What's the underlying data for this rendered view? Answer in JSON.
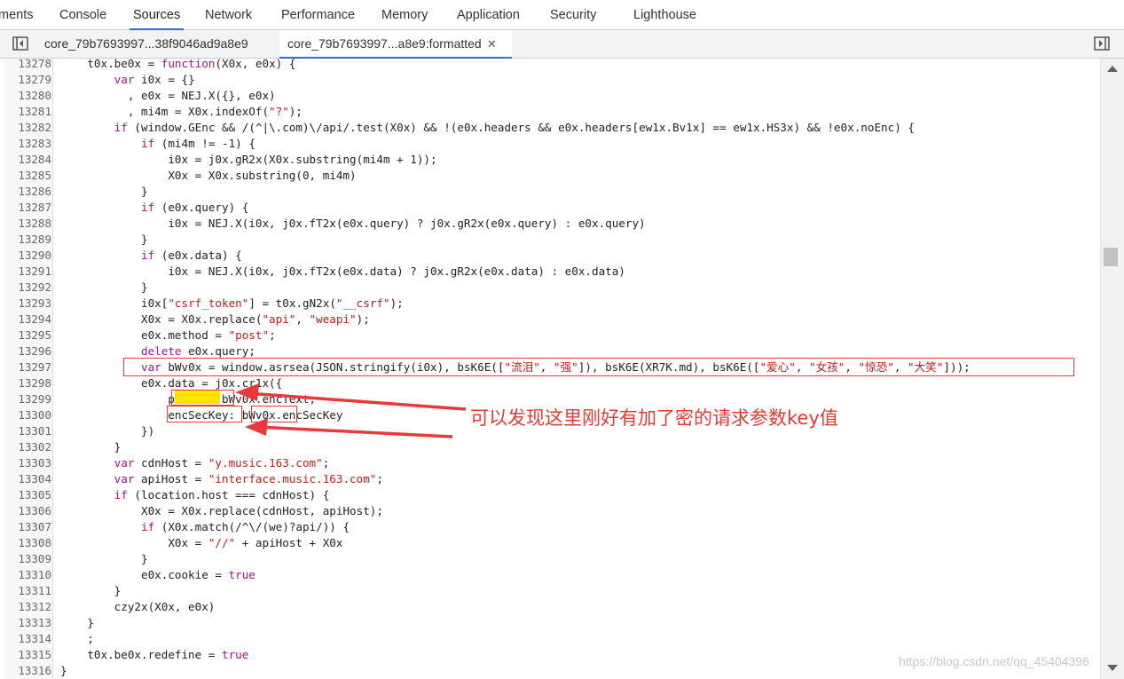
{
  "devtools_tabs": [
    {
      "label": "ments"
    },
    {
      "label": "Console"
    },
    {
      "label": "Sources"
    },
    {
      "label": "Network"
    },
    {
      "label": "Performance"
    },
    {
      "label": "Memory"
    },
    {
      "label": "Application"
    },
    {
      "label": "Security"
    },
    {
      "label": "Lighthouse"
    }
  ],
  "active_tab": "Sources",
  "file_tabs": [
    {
      "label": "core_79b7693997...38f9046ad9a8e9"
    },
    {
      "label": "core_79b7693997...a8e9:formatted"
    }
  ],
  "close_glyph": "✕",
  "lines": [
    {
      "n": "13278",
      "t": "    t0x.be0x = function(X0x, e0x) {"
    },
    {
      "n": "13279",
      "t": "        var i0x = {}"
    },
    {
      "n": "13280",
      "t": "          , e0x = NEJ.X({}, e0x)"
    },
    {
      "n": "13281",
      "t": "          , mi4m = X0x.indexOf(\"?\");"
    },
    {
      "n": "13282",
      "t": "        if (window.GEnc && /(^|\\.com)\\/api/.test(X0x) && !(e0x.headers && e0x.headers[ew1x.Bv1x] == ew1x.HS3x) && !e0x.noEnc) {"
    },
    {
      "n": "13283",
      "t": "            if (mi4m != -1) {"
    },
    {
      "n": "13284",
      "t": "                i0x = j0x.gR2x(X0x.substring(mi4m + 1));"
    },
    {
      "n": "13285",
      "t": "                X0x = X0x.substring(0, mi4m)"
    },
    {
      "n": "13286",
      "t": "            }"
    },
    {
      "n": "13287",
      "t": "            if (e0x.query) {"
    },
    {
      "n": "13288",
      "t": "                i0x = NEJ.X(i0x, j0x.fT2x(e0x.query) ? j0x.gR2x(e0x.query) : e0x.query)"
    },
    {
      "n": "13289",
      "t": "            }"
    },
    {
      "n": "13290",
      "t": "            if (e0x.data) {"
    },
    {
      "n": "13291",
      "t": "                i0x = NEJ.X(i0x, j0x.fT2x(e0x.data) ? j0x.gR2x(e0x.data) : e0x.data)"
    },
    {
      "n": "13292",
      "t": "            }"
    },
    {
      "n": "13293",
      "t": "            i0x[\"csrf_token\"] = t0x.gN2x(\"__csrf\");"
    },
    {
      "n": "13294",
      "t": "            X0x = X0x.replace(\"api\", \"weapi\");"
    },
    {
      "n": "13295",
      "t": "            e0x.method = \"post\";"
    },
    {
      "n": "13296",
      "t": "            delete e0x.query;"
    },
    {
      "n": "13297",
      "t": "            var bWv0x = window.asrsea(JSON.stringify(i0x), bsK6E([\"流泪\", \"强\"]), bsK6E(XR7K.md), bsK6E([\"爱心\", \"女孩\", \"惊恐\", \"大笑\"]));"
    },
    {
      "n": "13298",
      "t": "            e0x.data = j0x.cr1x({"
    },
    {
      "n": "13299",
      "t": "                params: bWv0x.encText,"
    },
    {
      "n": "13300",
      "t": "                encSecKey: bWv0x.encSecKey"
    },
    {
      "n": "13301",
      "t": "            })"
    },
    {
      "n": "13302",
      "t": "        }"
    },
    {
      "n": "13303",
      "t": "        var cdnHost = \"y.music.163.com\";"
    },
    {
      "n": "13304",
      "t": "        var apiHost = \"interface.music.163.com\";"
    },
    {
      "n": "13305",
      "t": "        if (location.host === cdnHost) {"
    },
    {
      "n": "13306",
      "t": "            X0x = X0x.replace(cdnHost, apiHost);"
    },
    {
      "n": "13307",
      "t": "            if (X0x.match(/^\\/(we)?api/)) {"
    },
    {
      "n": "13308",
      "t": "                X0x = \"//\" + apiHost + X0x"
    },
    {
      "n": "13309",
      "t": "            }"
    },
    {
      "n": "13310",
      "t": "            e0x.cookie = true"
    },
    {
      "n": "13311",
      "t": "        }"
    },
    {
      "n": "13312",
      "t": "        czy2x(X0x, e0x)"
    },
    {
      "n": "13313",
      "t": "    }"
    },
    {
      "n": "13314",
      "t": "    ;"
    },
    {
      "n": "13315",
      "t": "    t0x.be0x.redefine = true"
    },
    {
      "n": "13316",
      "t": "}"
    }
  ],
  "annotation": {
    "text": "可以发现这里刚好有加了密的请求参数key值",
    "color": "#e53b34"
  },
  "watermark": "https://blog.csdn.net/qq_45404396",
  "colors": {
    "keyword": "#aa0d91",
    "string": "#c41a16",
    "accent": "#1a73e8",
    "highlight": "#ffe400"
  }
}
